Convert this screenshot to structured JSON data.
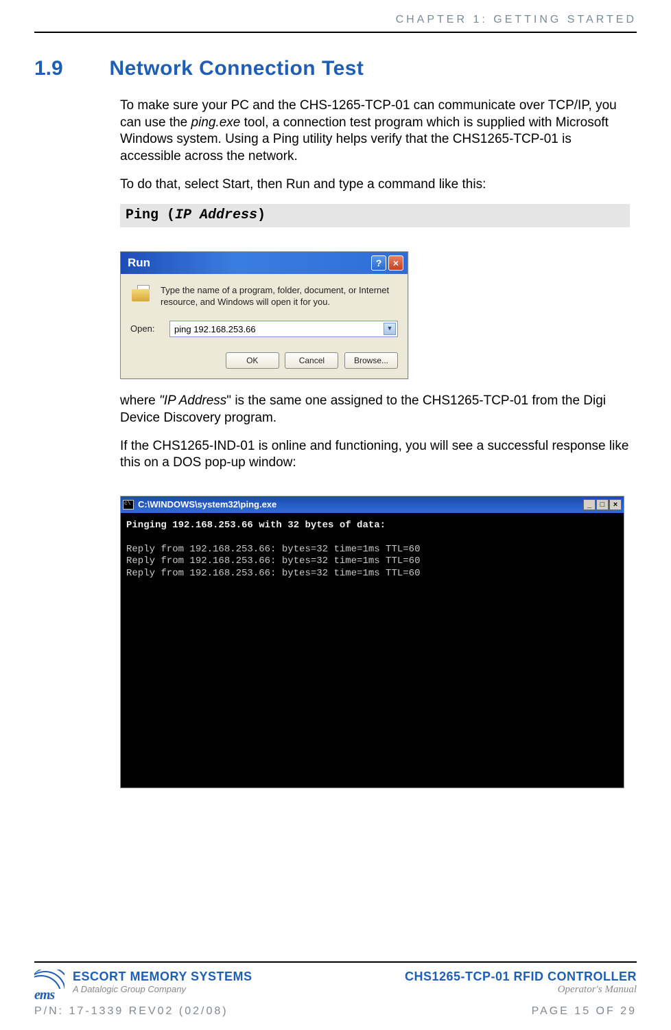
{
  "header": {
    "chapter": "CHAPTER 1: GETTING STARTED"
  },
  "section": {
    "number": "1.9",
    "title": "Network Connection Test"
  },
  "para1_a": "To make sure your PC and the CHS-1265-TCP-01 can communicate over TCP/IP, you can use the ",
  "para1_italic": "ping.exe",
  "para1_b": " tool, a connection test program which is supplied with Microsoft Windows system.  Using a Ping utility helps verify that the CHS1265-TCP-01 is accessible across the network.",
  "para2": "To do that, select Start, then Run and type a command like this:",
  "codebar_a": "Ping (",
  "codebar_italic": "IP Address",
  "codebar_b": ")",
  "run_dialog": {
    "title": "Run",
    "description": "Type the name of a program, folder, document, or Internet resource, and Windows will open it for you.",
    "open_label": "Open:",
    "open_value": "ping 192.168.253.66",
    "ok": "OK",
    "cancel": "Cancel",
    "browse": "Browse..."
  },
  "para3_a": "where ",
  "para3_italic": "\"IP Address",
  "para3_b": "\" is the same one assigned to the CHS1265-TCP-01 from the Digi Device Discovery program.",
  "para4": "If the CHS1265-IND-01 is online and functioning, you will see a successful response like this on a DOS pop-up window:",
  "cmd": {
    "title": "C:\\WINDOWS\\system32\\ping.exe",
    "line1": "Pinging 192.168.253.66 with 32 bytes of data:",
    "reply1": "Reply from 192.168.253.66: bytes=32 time=1ms TTL=60",
    "reply2": "Reply from 192.168.253.66: bytes=32 time=1ms TTL=60",
    "reply3": "Reply from 192.168.253.66: bytes=32 time=1ms TTL=60"
  },
  "footer": {
    "logo_text": "ems",
    "company": "ESCORT MEMORY SYSTEMS",
    "sub": "A Datalogic Group Company",
    "product": "CHS1265-TCP-01 RFID CONTROLLER",
    "manual": "Operator's Manual",
    "pn": "P/N: 17-1339 REV02 (02/08)",
    "page": "PAGE 15 OF 29"
  }
}
